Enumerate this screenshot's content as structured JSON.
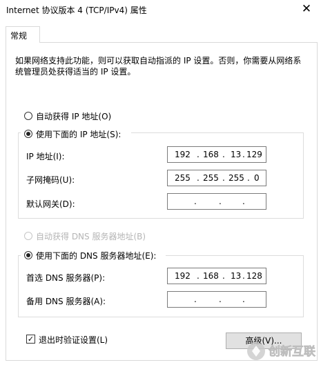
{
  "window": {
    "title": "Internet 协议版本 4 (TCP/IPv4) 属性",
    "close_glyph": "✕"
  },
  "tabs": [
    {
      "label": "常规"
    }
  ],
  "description": "如果网络支持此功能，则可以获取自动指派的 IP 设置。否则，你需要从网络系统管理员处获得适当的 IP 设置。",
  "ip": {
    "auto_label": "自动获得 IP 地址(O)",
    "manual_label": "使用下面的 IP 地址(S):",
    "selected": "manual",
    "address": {
      "label": "IP 地址(I):",
      "octets": [
        "192",
        "168",
        "13",
        "129"
      ]
    },
    "subnet": {
      "label": "子网掩码(U):",
      "octets": [
        "255",
        "255",
        "255",
        "0"
      ]
    },
    "gateway": {
      "label": "默认网关(D):",
      "octets": [
        "",
        "",
        "",
        ""
      ]
    }
  },
  "dns": {
    "auto_label": "自动获得 DNS 服务器地址(B)",
    "manual_label": "使用下面的 DNS 服务器地址(E):",
    "selected": "manual",
    "preferred": {
      "label": "首选 DNS 服务器(P):",
      "octets": [
        "192",
        "168",
        "13",
        "128"
      ]
    },
    "alternate": {
      "label": "备用 DNS 服务器(A):",
      "octets": [
        "",
        "",
        "",
        ""
      ]
    }
  },
  "validate": {
    "label": "退出时验证设置(L)",
    "checked": true,
    "check_glyph": "✓"
  },
  "advanced_button": {
    "label": "高级(V)..."
  },
  "watermark": {
    "text": "创新互联"
  },
  "colors": {
    "border": "#dcdcdc",
    "disabled_text": "#b5b5b5",
    "button_bg": "#e1e1e1"
  }
}
